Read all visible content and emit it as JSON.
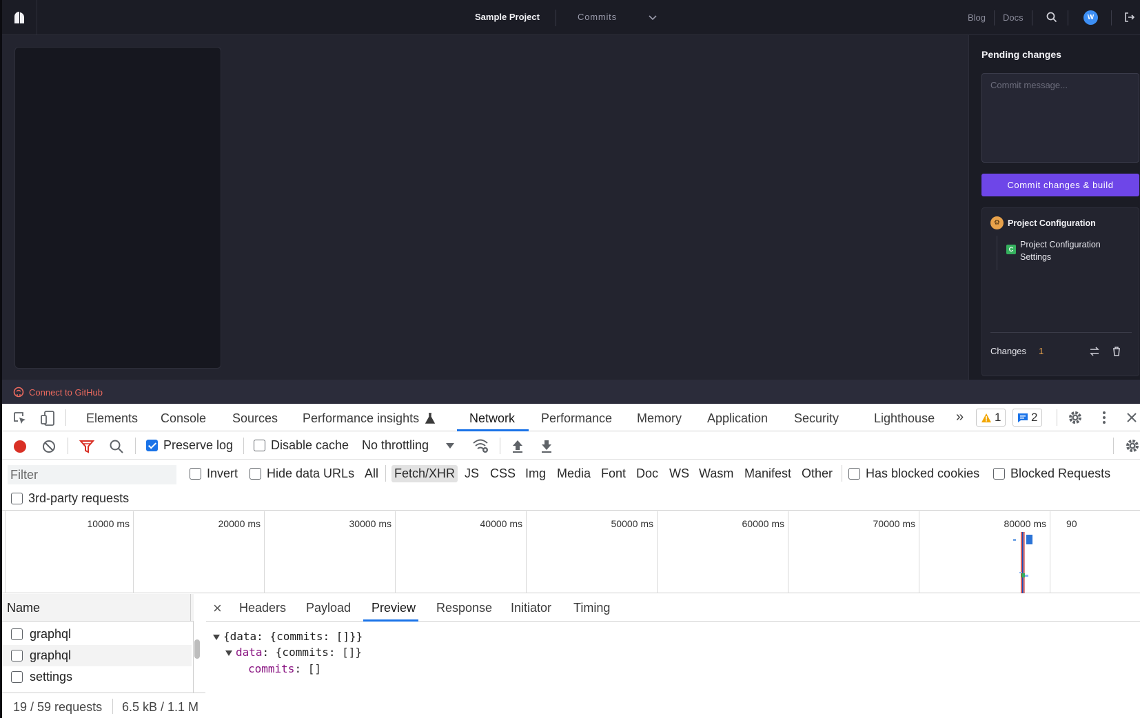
{
  "app": {
    "project_name": "Sample Project",
    "section_select": "Commits",
    "nav": {
      "blog": "Blog",
      "docs": "Docs"
    },
    "avatar_initial": "W",
    "footer_link": "Connect to GitHub"
  },
  "pending": {
    "title": "Pending changes",
    "commit_placeholder": "Commit message...",
    "commit_button": "Commit changes & build",
    "group_title": "Project Configuration",
    "group_badge": "⚙",
    "item_icon": "C",
    "item_label": "Project Configuration Settings",
    "changes_label": "Changes",
    "changes_count": "1"
  },
  "devtools": {
    "tabs": [
      "Elements",
      "Console",
      "Sources",
      "Performance insights",
      "Network",
      "Performance",
      "Memory",
      "Application",
      "Security",
      "Lighthouse"
    ],
    "active_tab": "Network",
    "warning_count": "1",
    "message_count": "2",
    "toolbar": {
      "preserve_log": "Preserve log",
      "disable_cache": "Disable cache",
      "throttling": "No throttling"
    },
    "filter": {
      "placeholder": "Filter",
      "invert": "Invert",
      "hide_data_urls": "Hide data URLs",
      "types": [
        "All",
        "Fetch/XHR",
        "JS",
        "CSS",
        "Img",
        "Media",
        "Font",
        "Doc",
        "WS",
        "Wasm",
        "Manifest",
        "Other"
      ],
      "active_type": "Fetch/XHR",
      "has_blocked_cookies": "Has blocked cookies",
      "blocked_requests": "Blocked Requests",
      "third_party": "3rd-party requests"
    },
    "timeline_ticks": [
      "10000 ms",
      "20000 ms",
      "30000 ms",
      "40000 ms",
      "50000 ms",
      "60000 ms",
      "70000 ms",
      "80000 ms",
      "90"
    ],
    "requests": {
      "header": "Name",
      "rows": [
        "graphql",
        "graphql",
        "settings"
      ],
      "summary_count": "19 / 59 requests",
      "summary_size": "6.5 kB / 1.1 M"
    },
    "detail": {
      "tabs": [
        "Headers",
        "Payload",
        "Preview",
        "Response",
        "Initiator",
        "Timing"
      ],
      "active_tab": "Preview",
      "json_root": "{data: {commits: []}}",
      "json_data_key": "data",
      "json_data_val": ": {commits: []}",
      "json_commits_key": "commits",
      "json_commits_val": ": []"
    }
  },
  "colors": {
    "accent": "#6e46e8",
    "warning": "#e8a24b",
    "github_link": "#ec6a5e",
    "devtools_active": "#1a73e8"
  }
}
